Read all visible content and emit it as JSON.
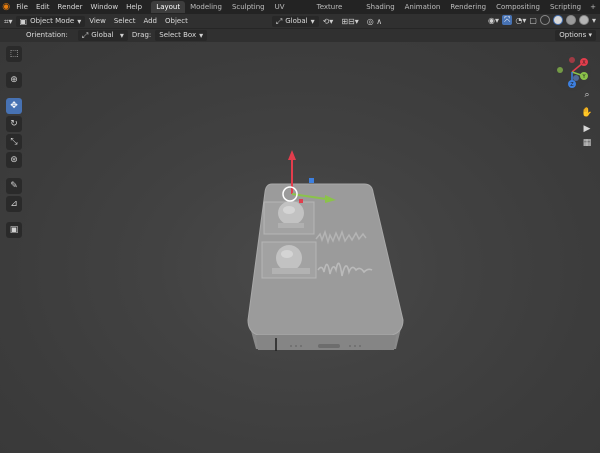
{
  "menubar": {
    "items": [
      "File",
      "Edit",
      "Render",
      "Window",
      "Help"
    ],
    "workspaces": [
      "Layout",
      "Modeling",
      "Sculpting",
      "UV Editing",
      "Texture Paint",
      "Shading",
      "Animation",
      "Rendering",
      "Compositing",
      "Scripting"
    ],
    "active_workspace": "Layout",
    "add_tab": "+"
  },
  "header": {
    "mode": "Object Mode",
    "menus": [
      "View",
      "Select",
      "Add",
      "Object"
    ],
    "transform_orientation": "Global"
  },
  "tool_settings": {
    "orientation_label": "Orientation:",
    "orientation_value": "Global",
    "drag_label": "Drag:",
    "drag_value": "Select Box",
    "options_label": "Options"
  },
  "toolbar": {
    "tools": [
      "select-box",
      "cursor",
      "move",
      "rotate",
      "scale",
      "transform",
      "annotate",
      "measure",
      "add-cube"
    ],
    "active_tool": "move"
  },
  "gizmo": {
    "x_label": "X",
    "y_label": "Y",
    "z_label": "Z"
  },
  "colors": {
    "accent": "#4772b3",
    "x_axis": "#e23d4c",
    "y_axis": "#8bc34a",
    "z_axis": "#3d80e0",
    "brand": "#e87d0d"
  }
}
